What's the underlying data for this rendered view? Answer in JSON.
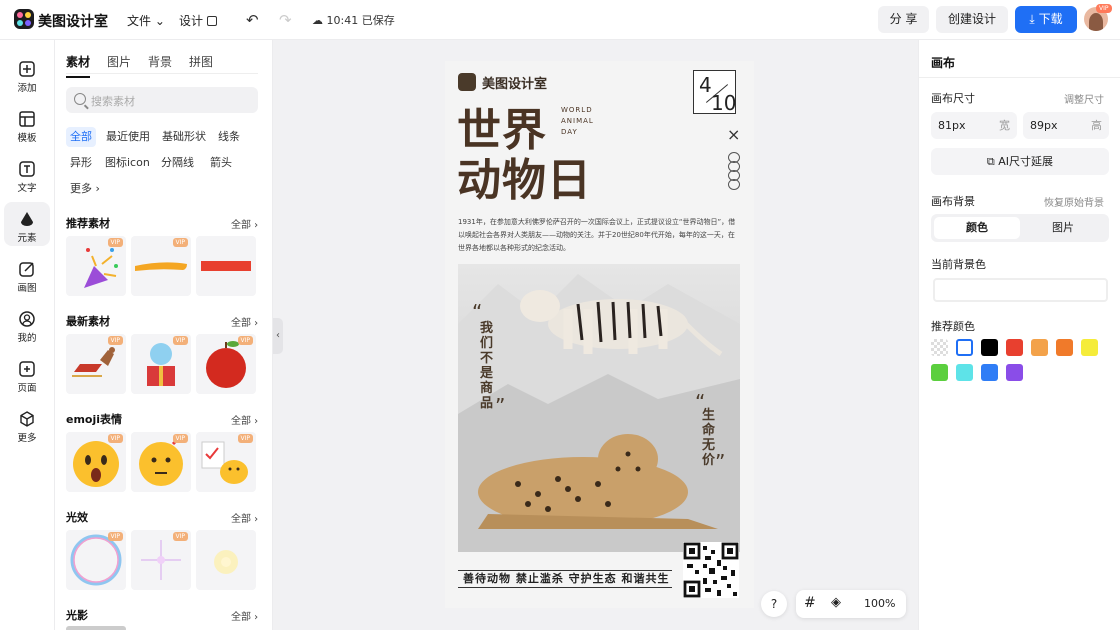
{
  "app": {
    "title": "美图设计室"
  },
  "topbar": {
    "file_label": "文件",
    "design_label": "设计",
    "saved_text": "10:41 已保存",
    "share_label": "分 享",
    "create_label": "创建设计",
    "download_label": "下载",
    "avatar_badge": "VIP"
  },
  "rail": [
    {
      "label": "添加",
      "icon": "plus-square-icon"
    },
    {
      "label": "模板",
      "icon": "template-icon"
    },
    {
      "label": "文字",
      "icon": "text-icon"
    },
    {
      "label": "元素",
      "icon": "shapes-icon"
    },
    {
      "label": "画图",
      "icon": "draw-icon"
    },
    {
      "label": "我的",
      "icon": "user-icon"
    },
    {
      "label": "页面",
      "icon": "page-add-icon"
    },
    {
      "label": "更多",
      "icon": "cube-icon"
    }
  ],
  "panel": {
    "tabs": [
      "素材",
      "图片",
      "背景",
      "拼图"
    ],
    "search_placeholder": "搜索素材",
    "chips": [
      "全部",
      "最近使用",
      "基础形状",
      "线条",
      "异形",
      "图标icon",
      "分隔线",
      "箭头",
      "更多 ›"
    ],
    "all_label": "全部",
    "vip_label": "VIP",
    "sections": [
      {
        "title": "推荐素材",
        "items": [
          "confetti-popper",
          "orange-brush-stroke",
          "red-rectangle"
        ]
      },
      {
        "title": "最新素材",
        "items": [
          "reindeer-sleigh",
          "snow-globe-gift",
          "red-apple"
        ]
      },
      {
        "title": "emoji表情",
        "items": [
          "shocked-emoji",
          "thinking-emoji",
          "chick-checklist-emoji"
        ]
      },
      {
        "title": "光效",
        "items": [
          "bubble-ring",
          "sparkle-star",
          "glow-light"
        ]
      },
      {
        "title": "光影",
        "items": []
      }
    ]
  },
  "poster": {
    "brand": "美图设计室",
    "title_line1": "世界",
    "title_line2": "动物日",
    "subtitle_lines": [
      "WORLD",
      "ANIMAL",
      "DAY"
    ],
    "date_top": "4",
    "date_bottom": "10",
    "close_mark": "×",
    "body": "1931年，在参加意大利佛罗伦萨召开的一次国际会议上，正式提议设立“世界动物日”，借以唤起社会各界对人类朋友——动物的关注。并于20世纪80年代开始，每年的这一天，在世界各地都以各种形式的纪念活动。",
    "quote_left": "我们不是商品",
    "quote_right": "生命无价",
    "slogan": "善待动物 禁止滥杀 守护生态 和谐共生"
  },
  "zoom": {
    "help": "?",
    "value": "100%"
  },
  "right": {
    "title": "画布",
    "size_label": "画布尺寸",
    "size_hint": "调整尺寸",
    "width_value": "81px",
    "width_unit": "宽",
    "height_value": "89px",
    "height_unit": "高",
    "ai_extend": "AI尺寸延展",
    "bg_label": "画布背景",
    "bg_hint": "恢复原始背景",
    "seg_color": "颜色",
    "seg_image": "图片",
    "current_bg_label": "当前背景色",
    "recommend_label": "推荐颜色",
    "colors": [
      "transparent",
      "#ffffff",
      "#000000",
      "#e8402f",
      "#f3a24a",
      "#f07a2a",
      "#f5ec3a",
      "#5bcf3e",
      "#5ee3e8",
      "#2f7df6",
      "#8a4de8"
    ]
  }
}
